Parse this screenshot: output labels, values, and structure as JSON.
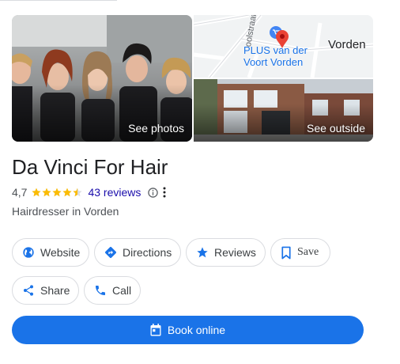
{
  "place": {
    "name": "Da Vinci For Hair",
    "rating": "4,7",
    "stars_filled": 4.5,
    "reviews": "43 reviews",
    "category": "Hairdresser in Vorden"
  },
  "media": {
    "photos_label": "See photos",
    "outside_label": "See outside",
    "map": {
      "town_label": "Vorden",
      "poi_line1": "PLUS van der",
      "poi_line2": "Voort Vorden",
      "street_label": "oolstraat"
    }
  },
  "actions": {
    "website": "Website",
    "directions": "Directions",
    "reviews": "Reviews",
    "save": "Save",
    "share": "Share",
    "call": "Call",
    "book": "Book online"
  },
  "colors": {
    "accent": "#1a73e8",
    "star": "#fbbc04",
    "link": "#1a0dab",
    "pin": "#ea4335"
  },
  "icons": {
    "website": "globe-icon",
    "directions": "directions-icon",
    "reviews": "star-icon",
    "save": "bookmark-icon",
    "share": "share-icon",
    "call": "phone-icon",
    "book": "calendar-icon"
  }
}
